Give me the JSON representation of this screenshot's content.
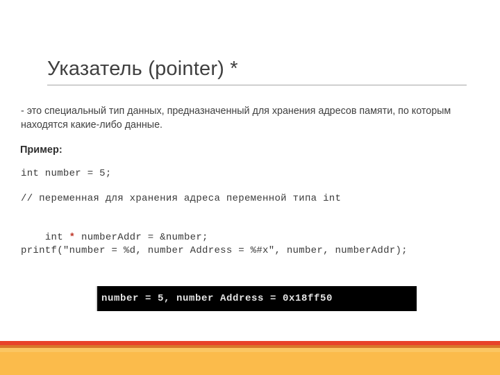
{
  "slide": {
    "title": "Указатель (pointer) *",
    "intro": "- это специальный тип данных, предназначенный для хранения адресов памяти, по которым находятся какие-либо данные.",
    "example_label": "Пример:",
    "code": {
      "line1": "int number = 5;",
      "line2": "// переменная для хранения адреса переменной типа int",
      "line3_prefix": "int ",
      "line3_star": "*",
      "line3_suffix": " numberAddr = &number;",
      "line4": "printf(\"number = %d, number Address = %#x\", number, numberAddr);"
    },
    "console": {
      "output": "number = 5, number Address = 0x18ff50"
    },
    "colors": {
      "title_text": "#3f3f3f",
      "body_text": "#3f3f3f",
      "code_text": "#3a3a3a",
      "pointer_star": "#c0392b",
      "console_background": "#000000",
      "console_text": "#e6e6e6",
      "band_red": "#e8432a",
      "band_dark_orange": "#d9762a",
      "band_amber": "#fbc662",
      "band_main": "#fbbb4b",
      "rule": "#a6a6a6"
    }
  }
}
